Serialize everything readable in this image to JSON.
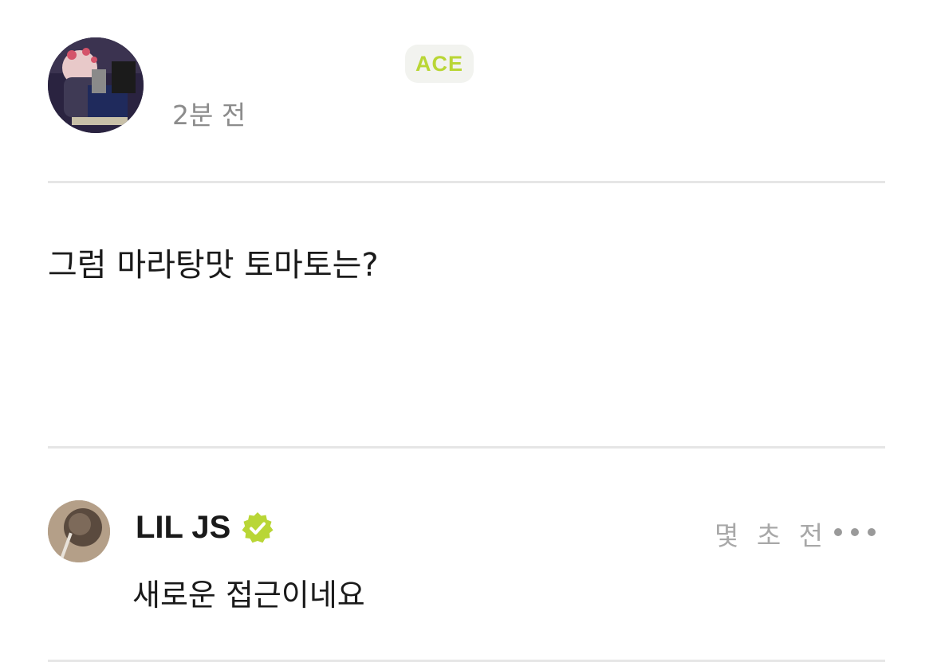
{
  "post": {
    "badge": "ACE",
    "time": "2분 전",
    "body": "그럼 마라탕맛 토마토는?"
  },
  "comment": {
    "author": "LIL JS",
    "time": "몇 초 전",
    "text": "새로운 접근이네요"
  },
  "colors": {
    "accent": "#b9d636",
    "badge_bg": "#f2f3ef",
    "muted_text": "#8c8c8c",
    "divider": "#e6e6e6"
  },
  "icons": {
    "verified": "verified-check-icon",
    "more": "more-horizontal-icon"
  }
}
